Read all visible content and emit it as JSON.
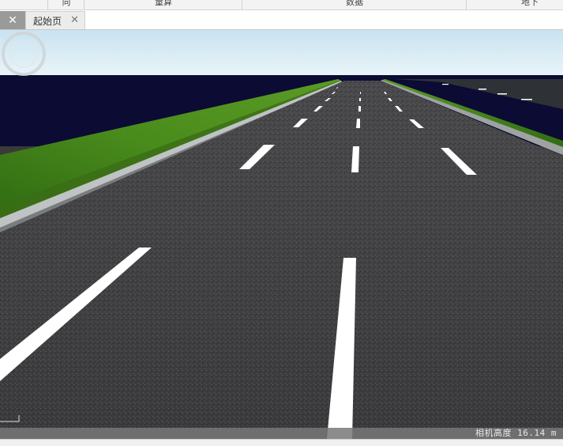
{
  "ribbon": {
    "groups": [
      "向",
      "量算",
      "数据",
      "地下"
    ]
  },
  "tabs": [
    {
      "label": "",
      "active": true,
      "close_icon": "close-icon"
    },
    {
      "label": "起始页",
      "active": false,
      "close_icon": "close-icon"
    }
  ],
  "viewport": {
    "scene": "3d-road",
    "colors": {
      "sky_top": "#cfe6f2",
      "sky_bottom": "#e6f2f8",
      "horizon_dark": "#0b0b33",
      "grass": "#3f7d17",
      "asphalt": "#3c3c3e",
      "lane_mark": "#ffffff"
    }
  },
  "status": {
    "camera_height_label": "相机高度",
    "camera_height_value": "16.14",
    "camera_height_unit": "m"
  }
}
